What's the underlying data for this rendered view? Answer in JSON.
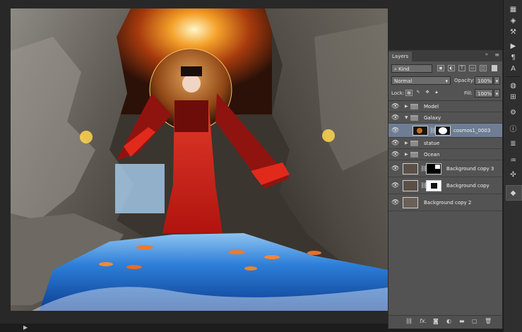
{
  "layers_panel": {
    "tab": "Layers",
    "filter": {
      "value": "Kind"
    },
    "blend_mode": {
      "value": "Normal"
    },
    "opacity": {
      "label": "Opacity:",
      "value": "100%"
    },
    "lock": {
      "label": "Lock:"
    },
    "fill": {
      "label": "Fill:",
      "value": "100%"
    },
    "layers": [
      {
        "name": "Model",
        "kind": "group",
        "expanded": false,
        "visible": true
      },
      {
        "name": "Galaxy",
        "kind": "group",
        "expanded": true,
        "visible": true
      },
      {
        "name": "cosmos1_0003",
        "kind": "layer",
        "selected": true,
        "visible": true
      },
      {
        "name": "statue",
        "kind": "group",
        "expanded": false,
        "visible": true
      },
      {
        "name": "Ocean",
        "kind": "group",
        "expanded": false,
        "visible": true
      },
      {
        "name": "Background copy 3",
        "kind": "layer",
        "visible": true
      },
      {
        "name": "Background copy",
        "kind": "layer",
        "visible": true
      },
      {
        "name": "Background copy 2",
        "kind": "layer",
        "visible": true
      }
    ],
    "footer_icons": [
      "link-icon",
      "fx-icon",
      "mask-icon",
      "adjustment-icon",
      "folder-icon",
      "new-layer-icon",
      "trash-icon"
    ]
  },
  "right_toolbar": {
    "icons": [
      "history-icon",
      "swatches-icon",
      "adjust-icon",
      "play-icon",
      "paragraph-icon",
      "char-icon",
      "brush-icon",
      "clone-icon",
      "tool-presets-icon",
      "info-icon",
      "properties-icon",
      "sliders-icon",
      "paths-icon",
      "channels-icon",
      "layers-icon"
    ]
  },
  "colors": {
    "panel_bg": "#535353",
    "selected_row": "#6e7d93",
    "water": "#1f6fd2",
    "robe": "#d9231c"
  }
}
